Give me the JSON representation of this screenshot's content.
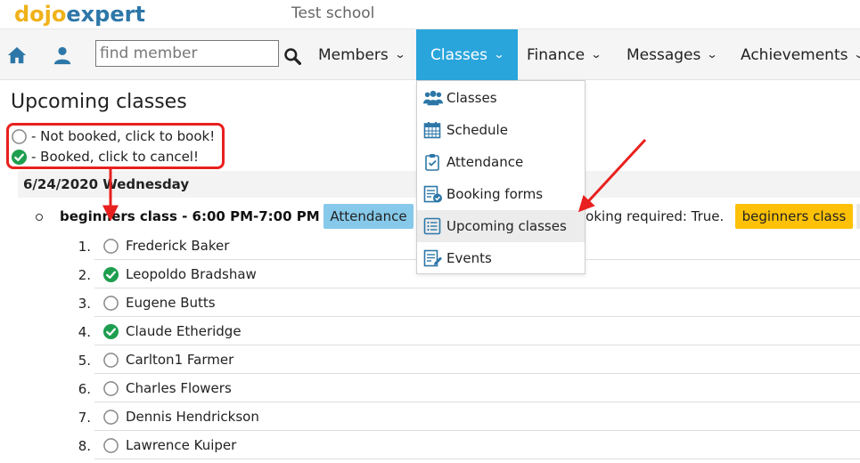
{
  "header": {
    "logo_part1": "dojo",
    "logo_part2": "expert",
    "school_name": "Test school"
  },
  "nav": {
    "search_placeholder": "find member",
    "items": [
      {
        "label": "Members"
      },
      {
        "label": "Classes"
      },
      {
        "label": "Finance"
      },
      {
        "label": "Messages"
      },
      {
        "label": "Achievements"
      }
    ],
    "active": "Classes"
  },
  "dropdown": {
    "items": [
      {
        "label": "Classes",
        "icon": "users-icon"
      },
      {
        "label": "Schedule",
        "icon": "calendar-icon"
      },
      {
        "label": "Attendance",
        "icon": "clipboard-check-icon"
      },
      {
        "label": "Booking forms",
        "icon": "form-check-icon"
      },
      {
        "label": "Upcoming classes",
        "icon": "list-icon"
      },
      {
        "label": "Events",
        "icon": "edit-list-icon"
      }
    ],
    "highlighted": "Upcoming classes"
  },
  "page": {
    "title": "Upcoming classes",
    "legend": {
      "not_booked": "- Not booked, click to book!",
      "booked": "- Booked, click to cancel!"
    },
    "date": "6/24/2020 Wednesday",
    "class": {
      "title": "beginners class - 6:00 PM-7:00 PM",
      "attendance_label": "Attendance",
      "booking_required": "ooking required: True.",
      "tag_label": "beginners class"
    },
    "members": [
      {
        "num": "1.",
        "name": "Frederick Baker",
        "booked": false
      },
      {
        "num": "2.",
        "name": "Leopoldo Bradshaw",
        "booked": true
      },
      {
        "num": "3.",
        "name": "Eugene Butts",
        "booked": false
      },
      {
        "num": "4.",
        "name": "Claude Etheridge",
        "booked": true
      },
      {
        "num": "5.",
        "name": "Carlton1 Farmer",
        "booked": false
      },
      {
        "num": "6.",
        "name": "Charles Flowers",
        "booked": false
      },
      {
        "num": "7.",
        "name": "Dennis Hendrickson",
        "booked": false
      },
      {
        "num": "8.",
        "name": "Lawrence Kuiper",
        "booked": false
      }
    ]
  },
  "colors": {
    "accent": "#2aa5dc",
    "booked_green": "#1e9e4f",
    "annotation_red": "#e8201f",
    "tag_yellow": "#fec107",
    "attendance_blue": "#86c9ea"
  }
}
